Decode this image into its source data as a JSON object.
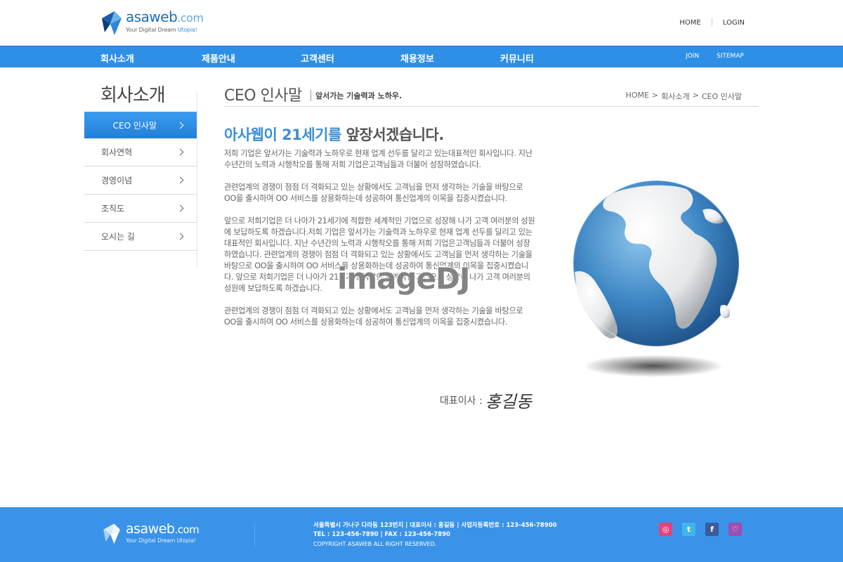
{
  "header": {
    "logo": {
      "name": "asaweb",
      "domain": ".com",
      "tagline_main": "Your Digital Dream",
      "tagline_accent": "Utopia!"
    },
    "links": [
      "HOME",
      "LOGIN"
    ]
  },
  "gnb": {
    "items": [
      "회사소개",
      "제품안내",
      "고객센터",
      "채용정보",
      "커뮤니티"
    ],
    "util": [
      "JOIN",
      "SITEMAP"
    ]
  },
  "sidebar": {
    "title": "회사소개",
    "items": [
      {
        "label": "CEO 인사말",
        "active": true
      },
      {
        "label": "회사연혁",
        "active": false
      },
      {
        "label": "경영이념",
        "active": false
      },
      {
        "label": "조직도",
        "active": false
      },
      {
        "label": "오시는 길",
        "active": false
      }
    ]
  },
  "content": {
    "title": "CEO 인사말",
    "subtitle": "앞서가는 기술력과 노하우.",
    "breadcrumb": [
      "HOME",
      ">",
      "회사소개",
      ">",
      "CEO 인사말"
    ],
    "headline_accent": "아사웹이 21세기를",
    "headline_rest": "앞장서겠습니다.",
    "paragraphs": [
      "저희 기업은 앞서가는 기술력과 노하우로 현재 업계 선두를 달리고 있는대표적인 회사입니다. 지난 수년간의 노력과 시행착오를 통해 저희 기업은고객님들과 더불어 성장하였습니다.",
      "관련업계의 경쟁이 점점 더 격화되고 있는 상황에서도 고객님을 먼저 생각하는 기술을 바탕으로 OO을 출시하여 OO 서비스를 상용화하는데 성공하여 통신업계의 이목을 집중시켰습니다.",
      "앞으로 저희기업은 더 나아가 21세기에 적합한 세계적인 기업으로 성장해 나가 고객 여러분의 성원에 보답하도록 하겠습니다.저희 기업은 앞서가는 기술력과 노하우로 현재 업계 선두를 달리고 있는대표적인 회사입니다. 지난 수년간의 노력과 시행착오를 통해 저희 기업은고객님들과 더불어 성장하였습니다. 관련업계의 경쟁이 점점 더 격화되고 있는 상황에서도 고객님을 먼저 생각하는 기술을 바탕으로 OO을 출시하여 OO 서비스를 상용화하는데 성공하여 통신업계의 이목을 집중시켰습니다. 앞으로 저희기업은 더 나아가 21세기에 적합한 세계적인 기업으로 성장해 나가 고객 여러분의 성원에 보답하도록 하겠습니다.",
      "관련업계의 경쟁이 점점 더 격화되고 있는 상황에서도 고객님을 먼저 생각하는 기술을 바탕으로 OO을 출시하여 OO 서비스를 상용화하는데 성공하여 통신업계의 이목을 집중시켰습니다."
    ],
    "signature_title": "대표이사 :",
    "signature_name": "홍길동",
    "watermark": "imageDJ"
  },
  "footer": {
    "logo": {
      "name": "asaweb",
      "domain": ".com",
      "tagline": "Your Digital Dream Utopia!"
    },
    "address_line": "서울특별시 가나구 다라동 123번지  |  대표이사 : 홍길동  |  사업자등록번호 : 123-456-78900",
    "contact_line": "TEL : 123-456-7890  |  FAX : 123-456-7890",
    "copyright": "COPYRIGHT ASAWEB ALL RIGHT RESERVED.",
    "sns": [
      {
        "icon": "camera-icon",
        "glyph": "◎",
        "color": "#e0457b"
      },
      {
        "icon": "twitter-icon",
        "glyph": "t",
        "color": "#3db6e8"
      },
      {
        "icon": "facebook-icon",
        "glyph": "f",
        "color": "#3b5b9a"
      },
      {
        "icon": "chat-icon",
        "glyph": "♡",
        "color": "#9b4fb3"
      }
    ]
  }
}
